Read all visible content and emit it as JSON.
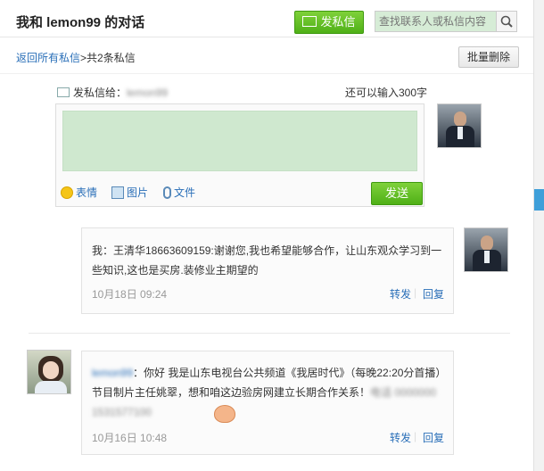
{
  "header": {
    "title": "我和 lemon99 的对话",
    "send_button": "发私信",
    "search_placeholder": "查找联系人或私信内容"
  },
  "breadcrumb": {
    "back_link": "返回所有私信",
    "separator": ">",
    "count": "共2条私信"
  },
  "batch_delete": "批量删除",
  "compose": {
    "to_label": "发私信给：",
    "to_name": "lemon99",
    "remaining": "还可以输入300字",
    "text": "",
    "tools": [
      "表情",
      "图片",
      "文件"
    ],
    "send_label": "发送"
  },
  "messages": [
    {
      "text": "我：王清华18663609159:谢谢您,我也希望能够合作，让山东观众学习到一些知识,这也是买房.装修业主期望的",
      "time": "10月18日 09:24",
      "forward": "转发",
      "reply": "回复"
    },
    {
      "sender": "lemon99",
      "sender_sep": "：",
      "text": "你好 我是山东电视台公共频道《我居时代》（每晚22:20分首播）节目制片主任姚翠，想和咱这边验房网建立长期合作关系！",
      "blurred_tail": "电话 0000000 1531577100",
      "time": "10月16日 10:48",
      "forward": "转发",
      "reply": "回复"
    }
  ]
}
